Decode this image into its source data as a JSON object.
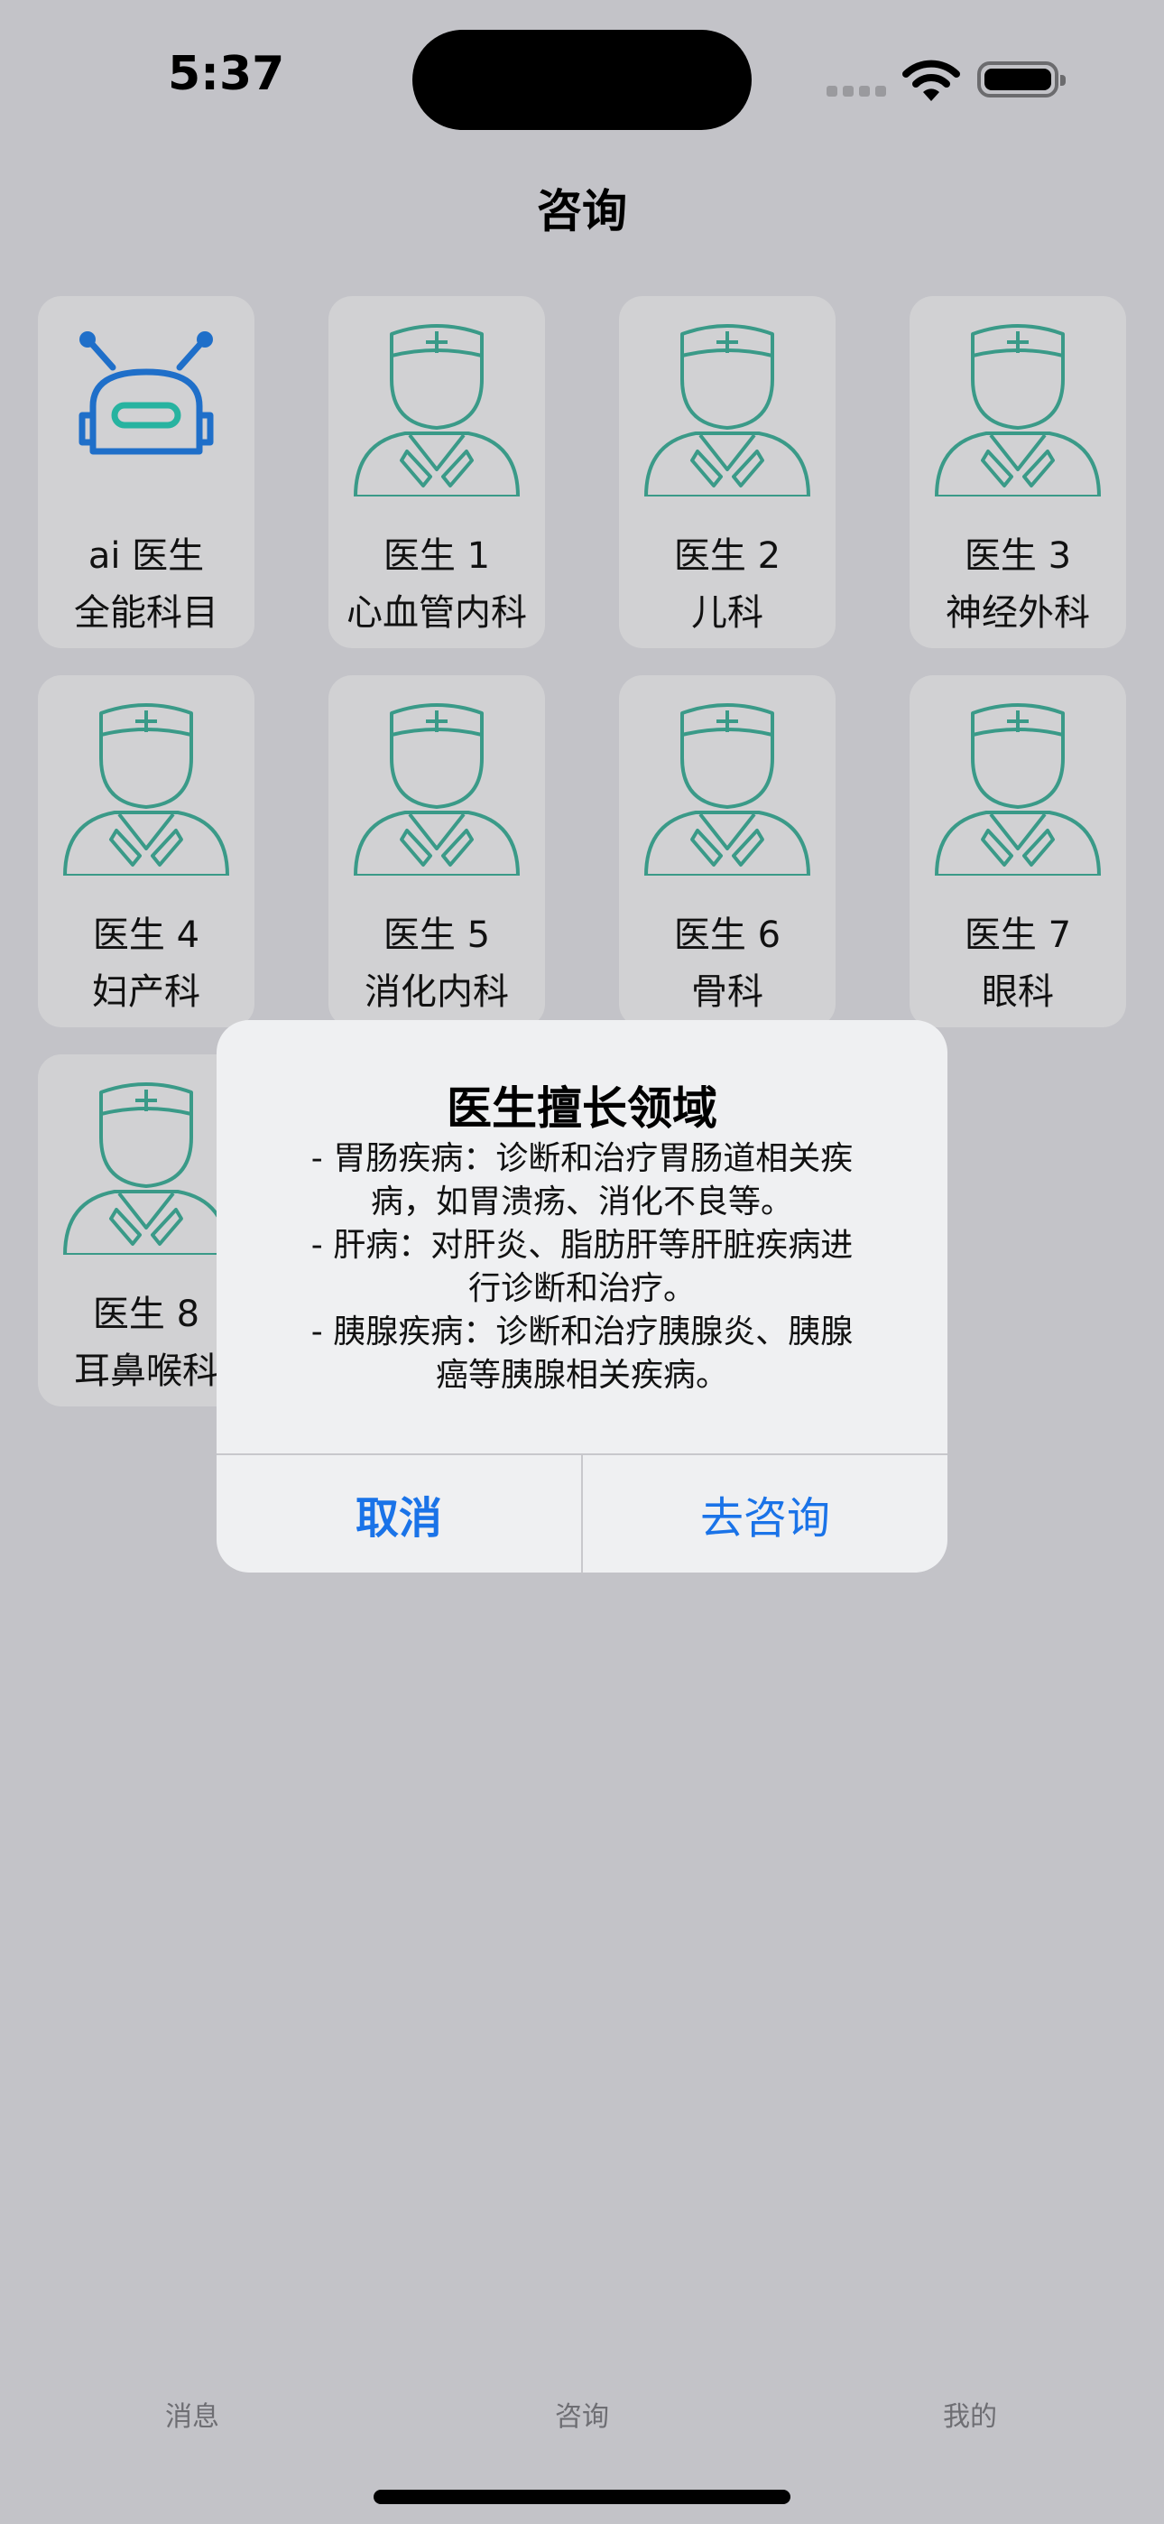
{
  "status_bar": {
    "time": "5:37"
  },
  "header": {
    "title": "咨询"
  },
  "doctors": [
    {
      "name": "ai 医生",
      "dept": "全能科目",
      "icon": "robot-icon"
    },
    {
      "name": "医生 1",
      "dept": "心血管内科",
      "icon": "doctor-icon"
    },
    {
      "name": "医生 2",
      "dept": "儿科",
      "icon": "doctor-icon"
    },
    {
      "name": "医生 3",
      "dept": "神经外科",
      "icon": "doctor-icon"
    },
    {
      "name": "医生 4",
      "dept": "妇产科",
      "icon": "doctor-icon"
    },
    {
      "name": "医生 5",
      "dept": "消化内科",
      "icon": "doctor-icon"
    },
    {
      "name": "医生 6",
      "dept": "骨科",
      "icon": "doctor-icon"
    },
    {
      "name": "医生 7",
      "dept": "眼科",
      "icon": "doctor-icon"
    },
    {
      "name": "医生 8",
      "dept": "耳鼻喉科",
      "icon": "doctor-icon"
    }
  ],
  "alert": {
    "title": "医生擅长领域",
    "lines": [
      "- 胃肠疾病：诊断和治疗胃肠道相关疾",
      "病，如胃溃疡、消化不良等。",
      "- 肝病：对肝炎、脂肪肝等肝脏疾病进",
      "行诊断和治疗。",
      "- 胰腺疾病：诊断和治疗胰腺炎、胰腺",
      "癌等胰腺相关疾病。"
    ],
    "cancel_label": "取消",
    "confirm_label": "去咨询"
  },
  "tab_bar": {
    "items": [
      {
        "label": "消息"
      },
      {
        "label": "咨询"
      },
      {
        "label": "我的"
      }
    ]
  },
  "colors": {
    "accent": "#1a73e8",
    "doctor_icon": "#3a9a88",
    "robot_icon": "#1f6fc9"
  }
}
